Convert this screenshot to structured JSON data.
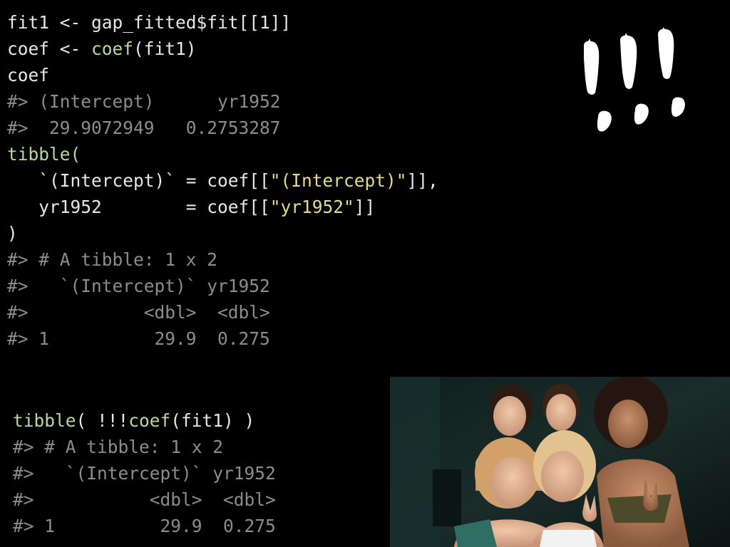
{
  "code_top": [
    [
      {
        "t": "fit1 <- gap_fitted$fit[[1]]",
        "c": "plain"
      }
    ],
    [
      {
        "t": "coef <- ",
        "c": "plain"
      },
      {
        "t": "coef",
        "c": "fn"
      },
      {
        "t": "(fit1)",
        "c": "plain"
      }
    ],
    [
      {
        "t": "coef",
        "c": "plain"
      }
    ],
    [
      {
        "t": "#> (Intercept)      yr1952",
        "c": "out"
      }
    ],
    [
      {
        "t": "#>  29.9072949   0.2753287",
        "c": "out"
      }
    ],
    [
      {
        "t": "tibble(",
        "c": "fn"
      }
    ],
    [
      {
        "t": "   `(Intercept)` = coef[[",
        "c": "plain"
      },
      {
        "t": "\"(Intercept)\"",
        "c": "str"
      },
      {
        "t": "]],",
        "c": "plain"
      }
    ],
    [
      {
        "t": "   yr1952        = coef[[",
        "c": "plain"
      },
      {
        "t": "\"yr1952\"",
        "c": "str"
      },
      {
        "t": "]]",
        "c": "plain"
      }
    ],
    [
      {
        "t": ")",
        "c": "plain"
      }
    ],
    [
      {
        "t": "#> # A tibble: 1 x 2",
        "c": "out"
      }
    ],
    [
      {
        "t": "#>   `(Intercept)` yr1952",
        "c": "out"
      }
    ],
    [
      {
        "t": "#>           <dbl>  <dbl>",
        "c": "out"
      }
    ],
    [
      {
        "t": "#> 1          29.9  0.275",
        "c": "out"
      }
    ]
  ],
  "code_bottom": [
    [
      {
        "t": "tibble",
        "c": "fn"
      },
      {
        "t": "( !!!",
        "c": "plain"
      },
      {
        "t": "coef",
        "c": "fn"
      },
      {
        "t": "(fit1) )",
        "c": "plain"
      }
    ],
    [
      {
        "t": "#> # A tibble: 1 x 2",
        "c": "out"
      }
    ],
    [
      {
        "t": "#>   `(Intercept)` yr1952",
        "c": "out"
      }
    ],
    [
      {
        "t": "#>           <dbl>  <dbl>",
        "c": "out"
      }
    ],
    [
      {
        "t": "#> 1          29.9  0.275",
        "c": "out"
      }
    ]
  ],
  "colors": {
    "background": "#000000",
    "code_plain": "#e6e6e6",
    "code_function": "#b9d79a",
    "code_string": "#e4da8e",
    "code_output": "#8c8c8c",
    "bang_marks": "#ffffff"
  },
  "decorations": {
    "bang_graphic": "three-hand-painted-exclamation-marks",
    "photo": "group-photo-five-women-smiling"
  }
}
